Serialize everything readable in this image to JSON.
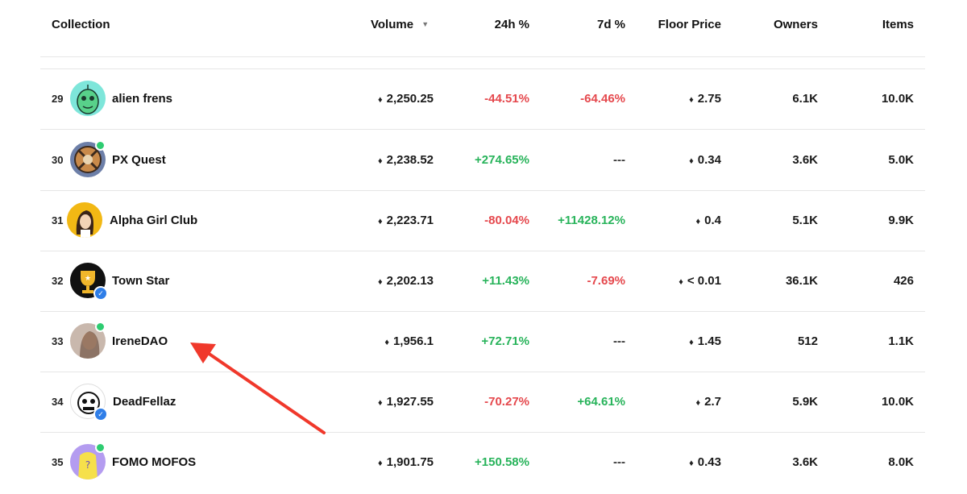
{
  "header": {
    "collection": "Collection",
    "volume": "Volume",
    "h24": "24h %",
    "d7": "7d %",
    "floor": "Floor Price",
    "owners": "Owners",
    "items": "Items"
  },
  "rows": [
    {
      "rank": "29",
      "name": "alien frens",
      "volume": "2,250.25",
      "h24": "-44.51%",
      "d7": "-64.46%",
      "floor": "2.75",
      "owners": "6.1K",
      "items": "10.0K"
    },
    {
      "rank": "30",
      "name": "PX Quest",
      "volume": "2,238.52",
      "h24": "+274.65%",
      "d7": "---",
      "floor": "0.34",
      "owners": "3.6K",
      "items": "5.0K"
    },
    {
      "rank": "31",
      "name": "Alpha Girl Club",
      "volume": "2,223.71",
      "h24": "-80.04%",
      "d7": "+11428.12%",
      "floor": "0.4",
      "owners": "5.1K",
      "items": "9.9K"
    },
    {
      "rank": "32",
      "name": "Town Star",
      "volume": "2,202.13",
      "h24": "+11.43%",
      "d7": "-7.69%",
      "floor": "< 0.01",
      "owners": "36.1K",
      "items": "426"
    },
    {
      "rank": "33",
      "name": "IreneDAO",
      "volume": "1,956.1",
      "h24": "+72.71%",
      "d7": "---",
      "floor": "1.45",
      "owners": "512",
      "items": "1.1K"
    },
    {
      "rank": "34",
      "name": "DeadFellaz",
      "volume": "1,927.55",
      "h24": "-70.27%",
      "d7": "+64.61%",
      "floor": "2.7",
      "owners": "5.9K",
      "items": "10.0K"
    },
    {
      "rank": "35",
      "name": "FOMO MOFOS",
      "volume": "1,901.75",
      "h24": "+150.58%",
      "d7": "---",
      "floor": "0.43",
      "owners": "3.6K",
      "items": "8.0K"
    }
  ],
  "colors": {
    "negative": "#e5484d",
    "positive": "#27b35a",
    "annotation_arrow": "#f0382b"
  }
}
